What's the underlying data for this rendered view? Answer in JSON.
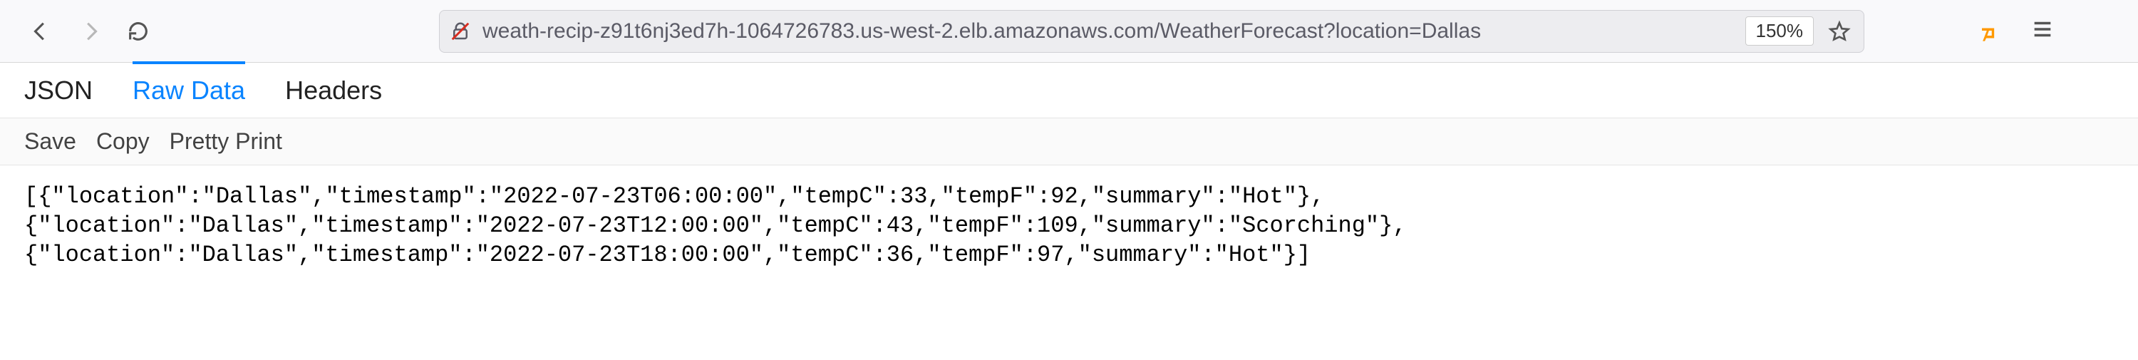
{
  "toolbar": {
    "url": "weath-recip-z91t6nj3ed7h-1064726783.us-west-2.elb.amazonaws.com/WeatherForecast?location=Dallas",
    "zoom": "150%"
  },
  "viewer": {
    "tabs": {
      "json": "JSON",
      "raw": "Raw Data",
      "headers": "Headers"
    },
    "actions": {
      "save": "Save",
      "copy": "Copy",
      "pretty": "Pretty Print"
    }
  },
  "body": {
    "line1": "[{\"location\":\"Dallas\",\"timestamp\":\"2022-07-23T06:00:00\",\"tempC\":33,\"tempF\":92,\"summary\":\"Hot\"},",
    "line2": "{\"location\":\"Dallas\",\"timestamp\":\"2022-07-23T12:00:00\",\"tempC\":43,\"tempF\":109,\"summary\":\"Scorching\"},",
    "line3": "{\"location\":\"Dallas\",\"timestamp\":\"2022-07-23T18:00:00\",\"tempC\":36,\"tempF\":97,\"summary\":\"Hot\"}]"
  }
}
